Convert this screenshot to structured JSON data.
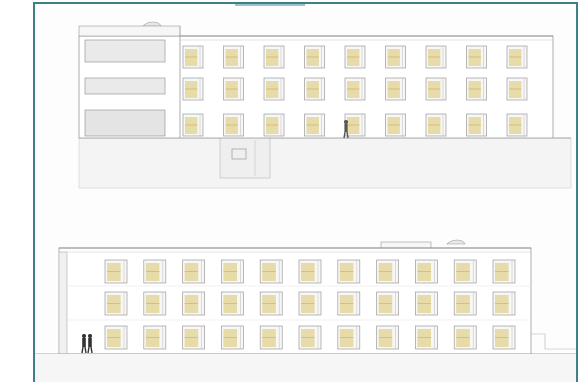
{
  "sheet": {
    "frame_color": "#3f7f86",
    "window_accent_color": "#d8c46a",
    "line_color": "#9a9a9a",
    "elevations": [
      {
        "name": "upper-elevation",
        "floors": 3,
        "window_bays": 9
      },
      {
        "name": "lower-elevation",
        "floors": 3,
        "window_bays": 11
      }
    ],
    "figures": [
      "person-silhouette",
      "couple-silhouette"
    ]
  }
}
